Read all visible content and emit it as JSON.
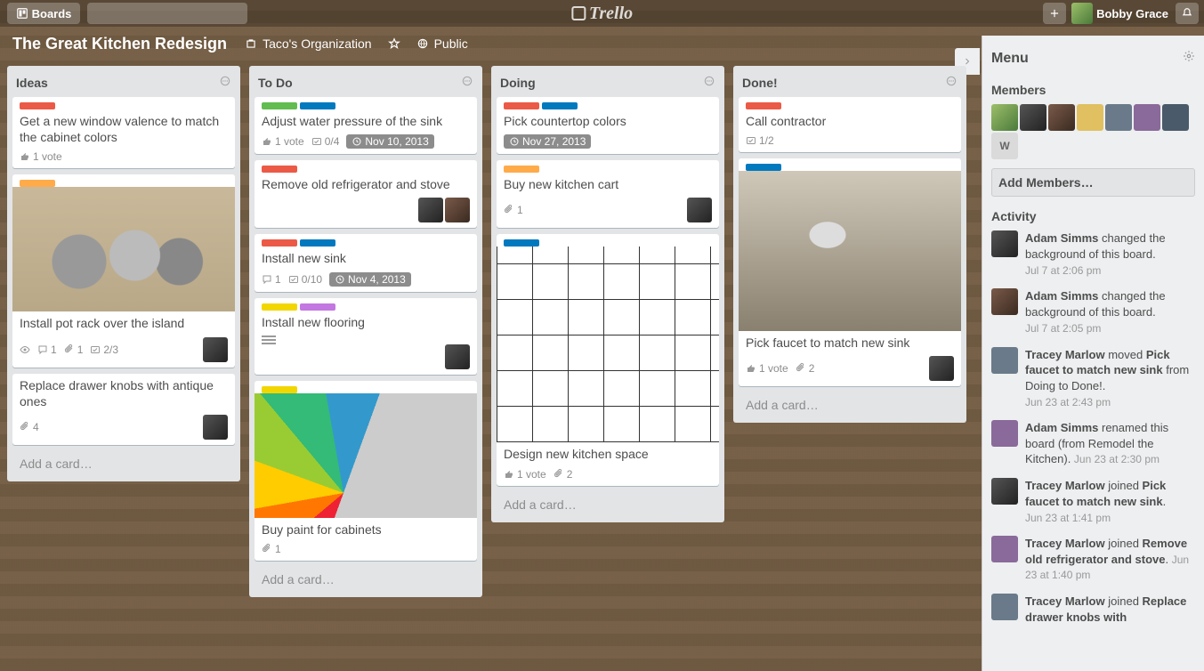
{
  "app": "Trello",
  "header": {
    "boards_label": "Boards",
    "user_name": "Bobby Grace"
  },
  "board": {
    "title": "The Great Kitchen Redesign",
    "org": "Taco's Organization",
    "visibility": "Public"
  },
  "lists": [
    {
      "title": "Ideas",
      "cards": [
        {
          "labels": [
            "red"
          ],
          "title": "Get a new window valence to match the cabinet colors",
          "votes": "1 vote"
        },
        {
          "labels": [
            "orange"
          ],
          "cover": "pots",
          "title": "Install pot rack over the island",
          "watch": true,
          "comments": "1",
          "attachments": "1",
          "checklist": "2/3",
          "members": 1
        },
        {
          "title": "Replace drawer knobs with antique ones",
          "attachments": "4",
          "members": 1
        }
      ],
      "add_label": "Add a card…"
    },
    {
      "title": "To Do",
      "cards": [
        {
          "labels": [
            "green",
            "blue"
          ],
          "title": "Adjust water pressure of the sink",
          "votes": "1 vote",
          "checklist": "0/4",
          "due": "Nov 10, 2013"
        },
        {
          "labels": [
            "red"
          ],
          "title": "Remove old refrigerator and stove",
          "members": 2
        },
        {
          "labels": [
            "red",
            "blue"
          ],
          "title": "Install new sink",
          "comments": "1",
          "checklist": "0/10",
          "due": "Nov 4, 2013"
        },
        {
          "labels": [
            "yellow",
            "purple"
          ],
          "title": "Install new flooring",
          "desc": true,
          "members": 1
        },
        {
          "labels": [
            "yellow"
          ],
          "cover": "paint",
          "title": "Buy paint for cabinets",
          "attachments": "1"
        }
      ],
      "add_label": "Add a card…"
    },
    {
      "title": "Doing",
      "cards": [
        {
          "labels": [
            "red",
            "blue"
          ],
          "title": "Pick countertop colors",
          "due": "Nov 27, 2013"
        },
        {
          "labels": [
            "orange"
          ],
          "title": "Buy new kitchen cart",
          "attachments": "1",
          "members": 1
        },
        {
          "labels": [
            "blue"
          ],
          "cover": "plan",
          "title": "Design new kitchen space",
          "votes": "1 vote",
          "attachments": "2"
        }
      ],
      "add_label": "Add a card…"
    },
    {
      "title": "Done!",
      "cards": [
        {
          "labels": [
            "red"
          ],
          "title": "Call contractor",
          "checklist": "1/2"
        },
        {
          "labels": [
            "blue"
          ],
          "cover": "faucet",
          "title": "Pick faucet to match new sink",
          "votes": "1 vote",
          "attachments": "2",
          "members": 1
        }
      ],
      "add_label": "Add a card…"
    }
  ],
  "sidebar": {
    "menu_label": "Menu",
    "members_label": "Members",
    "member_count": 7,
    "add_members_label": "Add Members…",
    "activity_label": "Activity",
    "activity": [
      {
        "user": "Adam Simms",
        "text_before": " changed the background of this board.",
        "object": "",
        "text_after": "",
        "time": "Jul 7 at 2:06 pm"
      },
      {
        "user": "Adam Simms",
        "text_before": " changed the background of this board.",
        "object": "",
        "text_after": "",
        "time": "Jul 7 at 2:05 pm"
      },
      {
        "user": "Tracey Marlow",
        "text_before": " moved ",
        "object": "Pick faucet to match new sink",
        "text_after": " from Doing to Done!.",
        "time": "Jun 23 at 2:43 pm"
      },
      {
        "user": "Adam Simms",
        "text_before": " renamed this board (from Remodel the Kitchen).",
        "object": "",
        "text_after": "",
        "time": "Jun 23 at 2:30 pm",
        "inline_time": true
      },
      {
        "user": "Tracey Marlow",
        "text_before": " joined ",
        "object": "Pick faucet to match new sink",
        "text_after": ".",
        "time": "Jun 23 at 1:41 pm"
      },
      {
        "user": "Tracey Marlow",
        "text_before": " joined ",
        "object": "Remove old refrigerator and stove",
        "text_after": ".",
        "time": "Jun 23 at 1:40 pm",
        "inline_time": true
      },
      {
        "user": "Tracey Marlow",
        "text_before": " joined ",
        "object": "Replace drawer knobs with",
        "text_after": "",
        "time": ""
      }
    ]
  }
}
